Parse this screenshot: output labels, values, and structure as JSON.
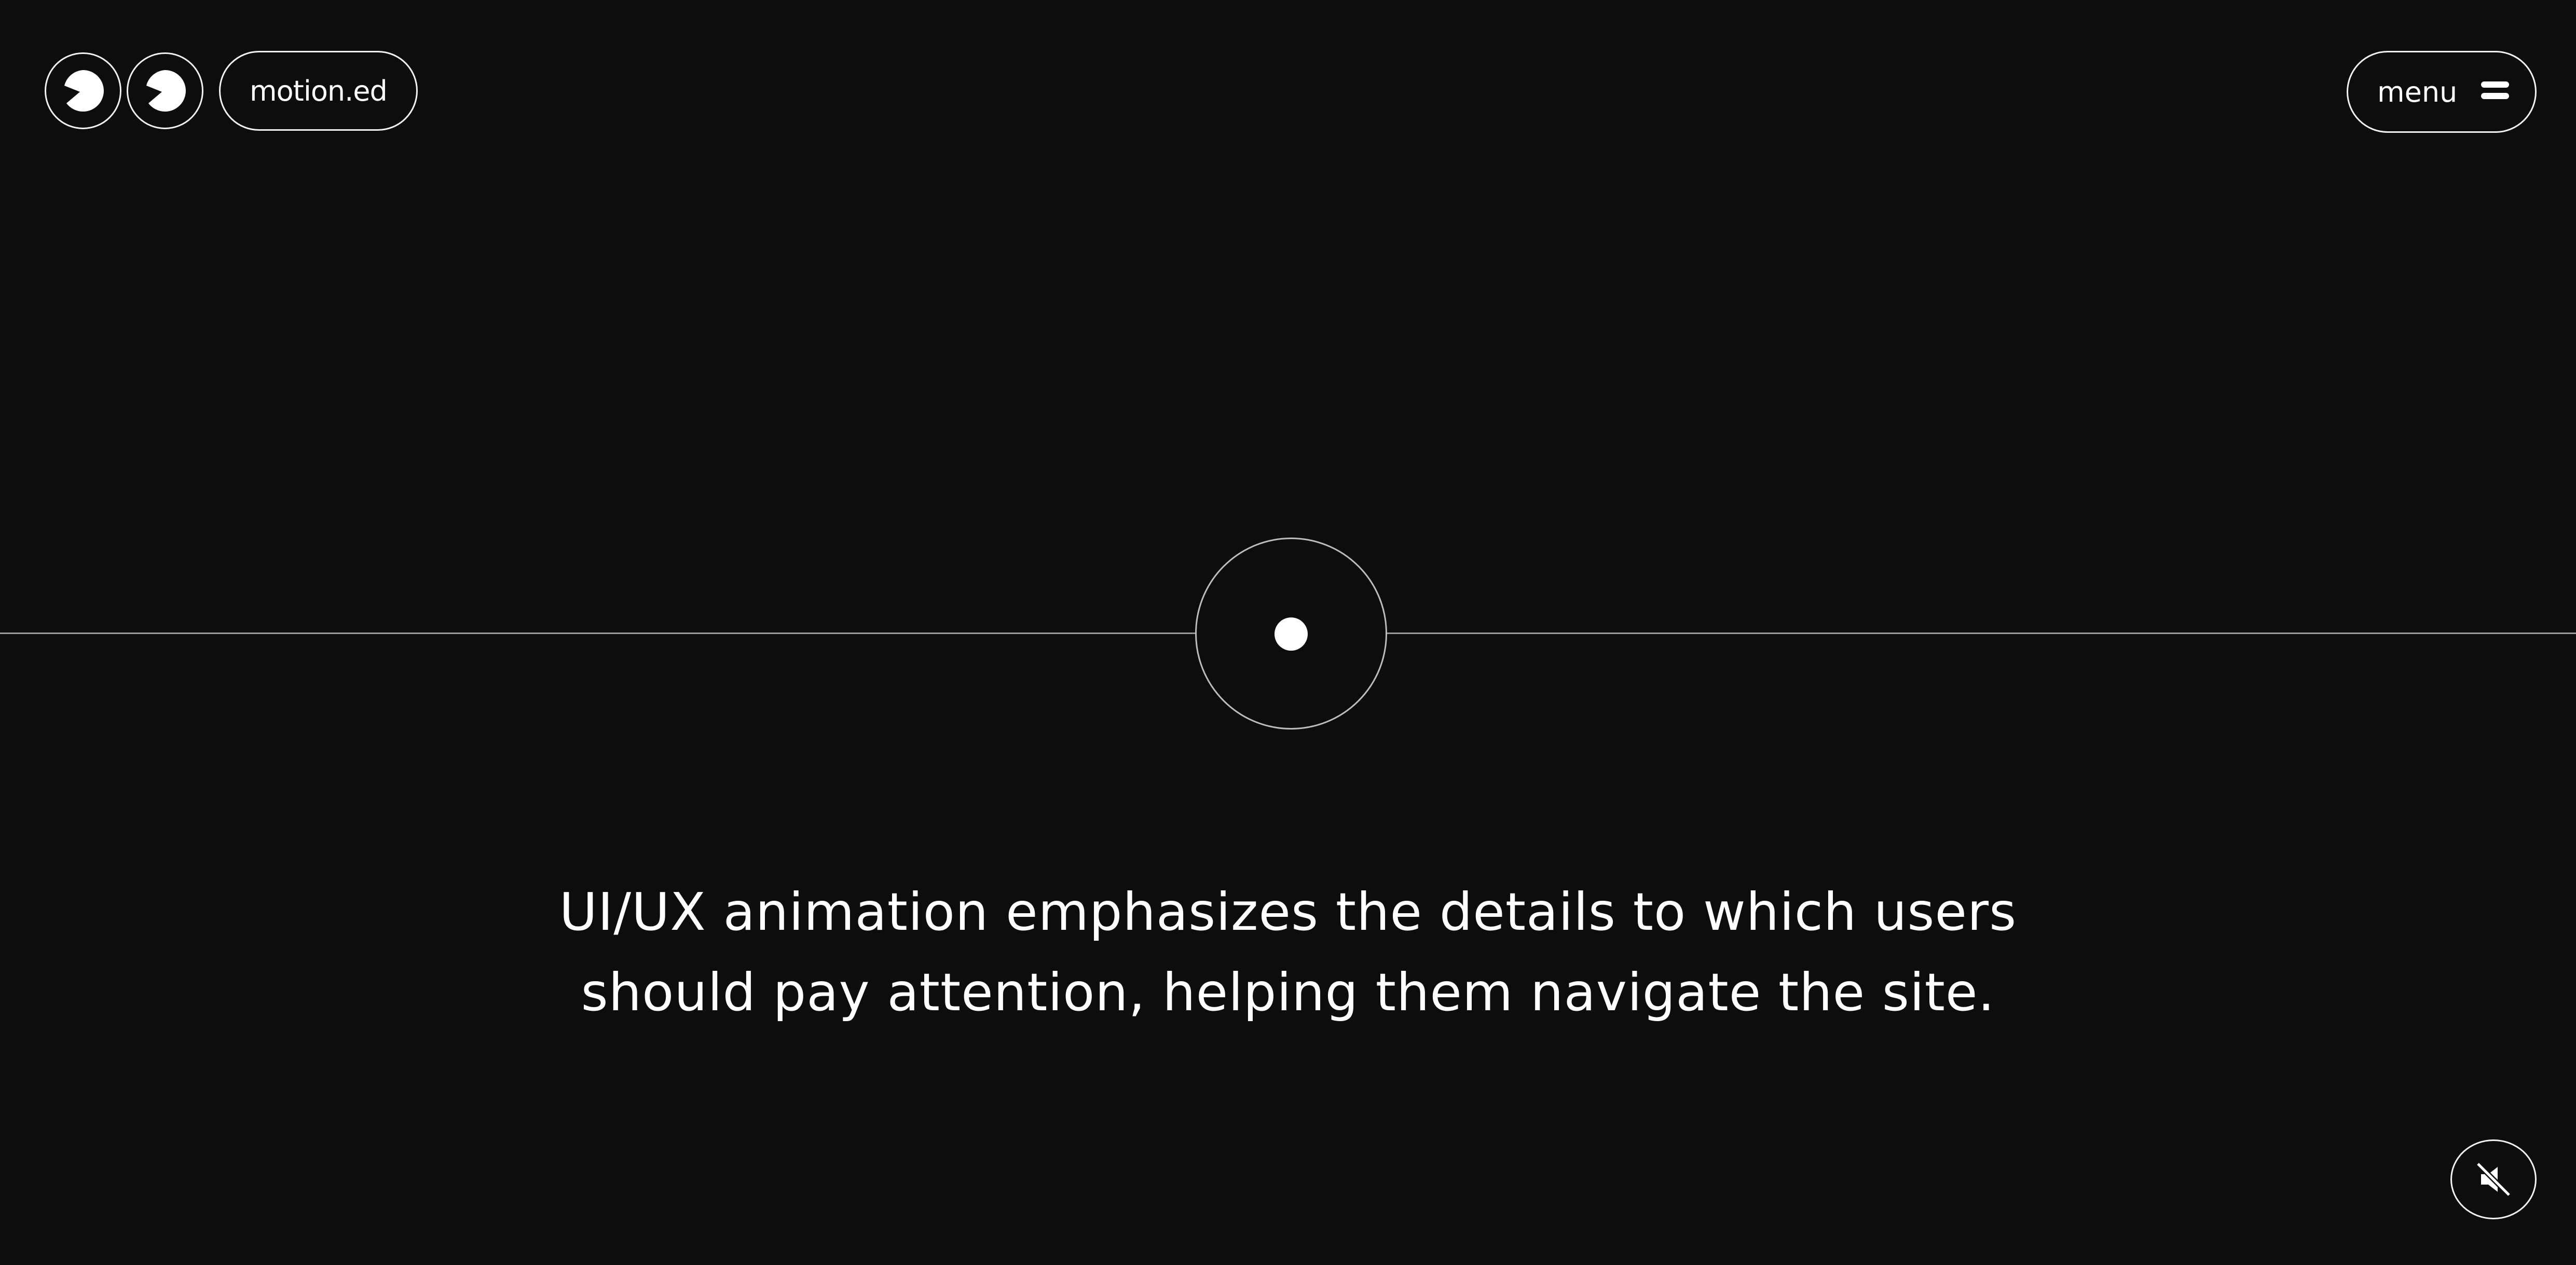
{
  "header": {
    "logo": {
      "icon": "pacman-eyes-icon"
    },
    "brand": "motion.ed",
    "menu": {
      "label": "menu",
      "icon": "menu-lines-icon"
    }
  },
  "hero": {
    "indicator_icon": "scroll-indicator-icon",
    "headline_line1": "UI/UX animation emphasizes the details to which users",
    "headline_line2": "should pay attention, helping them navigate the site."
  },
  "controls": {
    "sound_icon": "sound-muted-icon"
  },
  "colors": {
    "background": "#0e0d0e",
    "foreground": "#ffffff",
    "line": "#9a9a9a"
  }
}
